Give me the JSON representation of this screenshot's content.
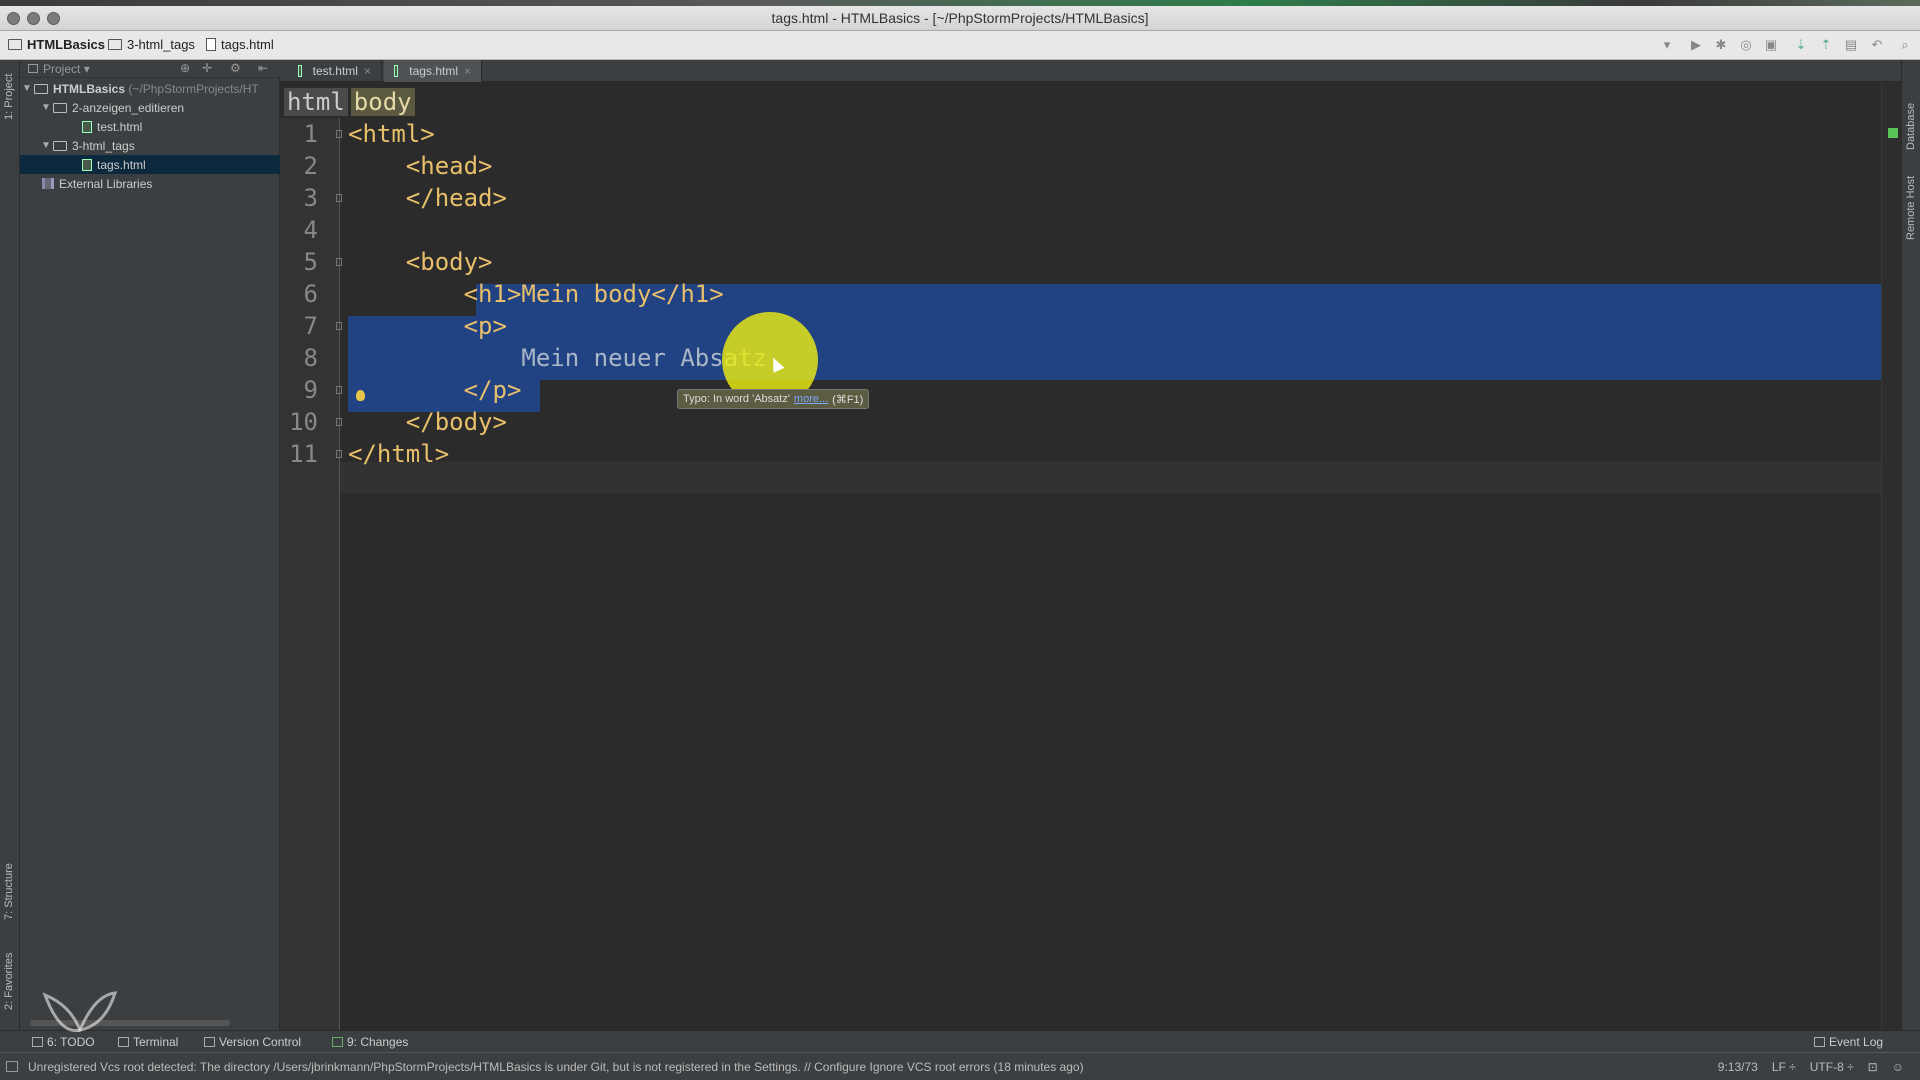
{
  "window": {
    "title": "tags.html - HTMLBasics - [~/PhpStormProjects/HTMLBasics]"
  },
  "breadcrumb": [
    "HTMLBasics",
    "3-html_tags",
    "tags.html"
  ],
  "left_strip": {
    "project_label": "1: Project",
    "structure_label": "7: Structure",
    "favorites_label": "2: Favorites"
  },
  "right_strip": {
    "database_label": "Database",
    "remote_label": "Remote Host"
  },
  "project_panel": {
    "header": "Project",
    "tree": [
      {
        "label": "HTMLBasics",
        "suffix": "(~/PhpStormProjects/HT",
        "type": "dir",
        "expanded": true
      },
      {
        "label": "2-anzeigen_editieren",
        "type": "dir",
        "expanded": true
      },
      {
        "label": "test.html",
        "type": "file"
      },
      {
        "label": "3-html_tags",
        "type": "dir",
        "expanded": true
      },
      {
        "label": "tags.html",
        "type": "file",
        "selected": true
      },
      {
        "label": "External Libraries",
        "type": "lib"
      }
    ]
  },
  "editor": {
    "tabs": [
      {
        "label": "test.html",
        "active": false
      },
      {
        "label": "tags.html",
        "active": true
      }
    ],
    "tag_breadcrumb": [
      "html",
      "body"
    ],
    "lines": [
      {
        "n": "1",
        "code": "<html>"
      },
      {
        "n": "2",
        "code": "    <head>"
      },
      {
        "n": "3",
        "code": "    </head>"
      },
      {
        "n": "4",
        "code": ""
      },
      {
        "n": "5",
        "code": "    <body>"
      },
      {
        "n": "6",
        "code": "        <h1>Mein body</h1>"
      },
      {
        "n": "7",
        "code": "        <p>"
      },
      {
        "n": "8",
        "code": "            Mein neuer Absatz"
      },
      {
        "n": "9",
        "code": "        </p>"
      },
      {
        "n": "10",
        "code": "    </body>"
      },
      {
        "n": "11",
        "code": "</html>"
      }
    ],
    "tooltip": {
      "text": "Typo: In word 'Absatz'",
      "link": "more...",
      "shortcut": "(⌘F1)"
    }
  },
  "bottom_tools": [
    {
      "label": "6: TODO"
    },
    {
      "label": "Terminal"
    },
    {
      "label": "Version Control"
    },
    {
      "label": "9: Changes"
    }
  ],
  "event_log_label": "Event Log",
  "status": {
    "message": "Unregistered Vcs root detected: The directory /Users/jbrinkmann/PhpStormProjects/HTMLBasics is under Git, but is not registered in the Settings. // Configure  Ignore VCS root errors (18 minutes ago)",
    "position": "9:13/73",
    "line_sep": "LF ÷",
    "encoding": "UTF-8 ÷"
  }
}
